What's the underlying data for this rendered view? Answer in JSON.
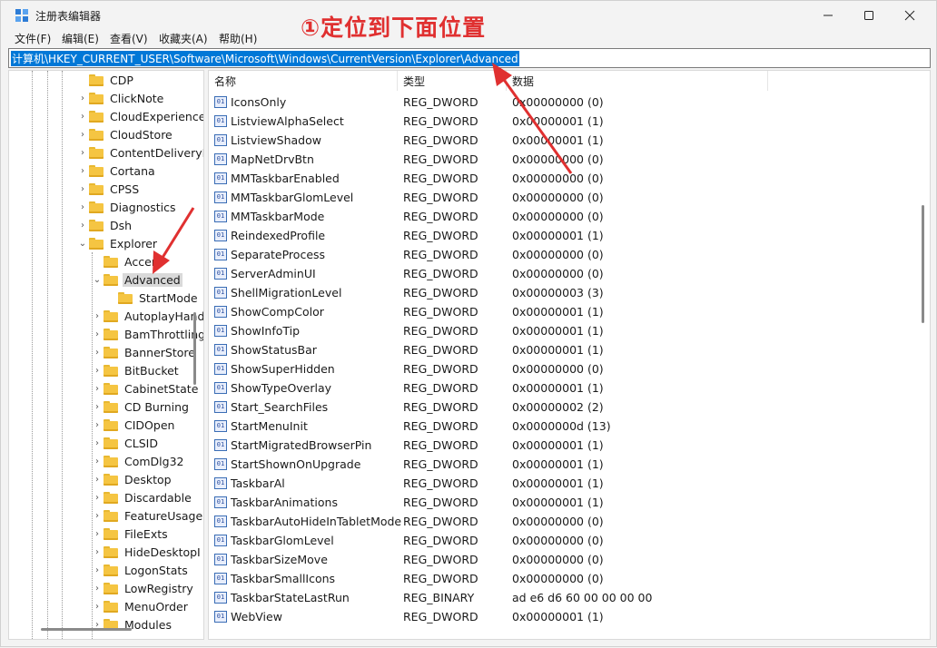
{
  "window": {
    "title": "注册表编辑器",
    "annotation": "①定位到下面位置"
  },
  "menu": [
    "文件(F)",
    "编辑(E)",
    "查看(V)",
    "收藏夹(A)",
    "帮助(H)"
  ],
  "address": "计算机\\HKEY_CURRENT_USER\\Software\\Microsoft\\Windows\\CurrentVersion\\Explorer\\Advanced",
  "tree": [
    {
      "label": "CDP",
      "level": 0,
      "chevron": "none"
    },
    {
      "label": "ClickNote",
      "level": 0,
      "chevron": "right"
    },
    {
      "label": "CloudExperience",
      "level": 0,
      "chevron": "right"
    },
    {
      "label": "CloudStore",
      "level": 0,
      "chevron": "right"
    },
    {
      "label": "ContentDeliveryI",
      "level": 0,
      "chevron": "right"
    },
    {
      "label": "Cortana",
      "level": 0,
      "chevron": "right"
    },
    {
      "label": "CPSS",
      "level": 0,
      "chevron": "right"
    },
    {
      "label": "Diagnostics",
      "level": 0,
      "chevron": "right"
    },
    {
      "label": "Dsh",
      "level": 0,
      "chevron": "right"
    },
    {
      "label": "Explorer",
      "level": 0,
      "chevron": "down"
    },
    {
      "label": "Accent",
      "level": 1,
      "chevron": "none"
    },
    {
      "label": "Advanced",
      "level": 1,
      "chevron": "down",
      "selected": true
    },
    {
      "label": "StartMode",
      "level": 2,
      "chevron": "none"
    },
    {
      "label": "AutoplayHand",
      "level": 1,
      "chevron": "right"
    },
    {
      "label": "BamThrottling",
      "level": 1,
      "chevron": "right"
    },
    {
      "label": "BannerStore",
      "level": 1,
      "chevron": "right"
    },
    {
      "label": "BitBucket",
      "level": 1,
      "chevron": "right"
    },
    {
      "label": "CabinetState",
      "level": 1,
      "chevron": "right"
    },
    {
      "label": "CD Burning",
      "level": 1,
      "chevron": "right"
    },
    {
      "label": "CIDOpen",
      "level": 1,
      "chevron": "right"
    },
    {
      "label": "CLSID",
      "level": 1,
      "chevron": "right"
    },
    {
      "label": "ComDlg32",
      "level": 1,
      "chevron": "right"
    },
    {
      "label": "Desktop",
      "level": 1,
      "chevron": "right"
    },
    {
      "label": "Discardable",
      "level": 1,
      "chevron": "right"
    },
    {
      "label": "FeatureUsage",
      "level": 1,
      "chevron": "right"
    },
    {
      "label": "FileExts",
      "level": 1,
      "chevron": "right"
    },
    {
      "label": "HideDesktopI",
      "level": 1,
      "chevron": "right"
    },
    {
      "label": "LogonStats",
      "level": 1,
      "chevron": "right"
    },
    {
      "label": "LowRegistry",
      "level": 1,
      "chevron": "right"
    },
    {
      "label": "MenuOrder",
      "level": 1,
      "chevron": "right"
    },
    {
      "label": "Modules",
      "level": 1,
      "chevron": "right"
    }
  ],
  "columns": [
    "名称",
    "类型",
    "数据"
  ],
  "rows": [
    [
      "IconsOnly",
      "REG_DWORD",
      "0x00000000 (0)"
    ],
    [
      "ListviewAlphaSelect",
      "REG_DWORD",
      "0x00000001 (1)"
    ],
    [
      "ListviewShadow",
      "REG_DWORD",
      "0x00000001 (1)"
    ],
    [
      "MapNetDrvBtn",
      "REG_DWORD",
      "0x00000000 (0)"
    ],
    [
      "MMTaskbarEnabled",
      "REG_DWORD",
      "0x00000000 (0)"
    ],
    [
      "MMTaskbarGlomLevel",
      "REG_DWORD",
      "0x00000000 (0)"
    ],
    [
      "MMTaskbarMode",
      "REG_DWORD",
      "0x00000000 (0)"
    ],
    [
      "ReindexedProfile",
      "REG_DWORD",
      "0x00000001 (1)"
    ],
    [
      "SeparateProcess",
      "REG_DWORD",
      "0x00000000 (0)"
    ],
    [
      "ServerAdminUI",
      "REG_DWORD",
      "0x00000000 (0)"
    ],
    [
      "ShellMigrationLevel",
      "REG_DWORD",
      "0x00000003 (3)"
    ],
    [
      "ShowCompColor",
      "REG_DWORD",
      "0x00000001 (1)"
    ],
    [
      "ShowInfoTip",
      "REG_DWORD",
      "0x00000001 (1)"
    ],
    [
      "ShowStatusBar",
      "REG_DWORD",
      "0x00000001 (1)"
    ],
    [
      "ShowSuperHidden",
      "REG_DWORD",
      "0x00000000 (0)"
    ],
    [
      "ShowTypeOverlay",
      "REG_DWORD",
      "0x00000001 (1)"
    ],
    [
      "Start_SearchFiles",
      "REG_DWORD",
      "0x00000002 (2)"
    ],
    [
      "StartMenuInit",
      "REG_DWORD",
      "0x0000000d (13)"
    ],
    [
      "StartMigratedBrowserPin",
      "REG_DWORD",
      "0x00000001 (1)"
    ],
    [
      "StartShownOnUpgrade",
      "REG_DWORD",
      "0x00000001 (1)"
    ],
    [
      "TaskbarAl",
      "REG_DWORD",
      "0x00000001 (1)"
    ],
    [
      "TaskbarAnimations",
      "REG_DWORD",
      "0x00000001 (1)"
    ],
    [
      "TaskbarAutoHideInTabletMode",
      "REG_DWORD",
      "0x00000000 (0)"
    ],
    [
      "TaskbarGlomLevel",
      "REG_DWORD",
      "0x00000000 (0)"
    ],
    [
      "TaskbarSizeMove",
      "REG_DWORD",
      "0x00000000 (0)"
    ],
    [
      "TaskbarSmallIcons",
      "REG_DWORD",
      "0x00000000 (0)"
    ],
    [
      "TaskbarStateLastRun",
      "REG_BINARY",
      "ad e6 d6 60 00 00 00 00"
    ],
    [
      "WebView",
      "REG_DWORD",
      "0x00000001 (1)"
    ]
  ],
  "icons": {
    "app": "registry-editor-icon",
    "minimize": "minimize-icon",
    "maximize": "maximize-icon",
    "close": "close-icon",
    "folder": "folder-icon",
    "value": "reg-dword-icon",
    "arrow": "red-arrow-icon"
  },
  "colors": {
    "selection": "#0078d7",
    "annotation": "#e03030",
    "folder": "#f5c542"
  }
}
